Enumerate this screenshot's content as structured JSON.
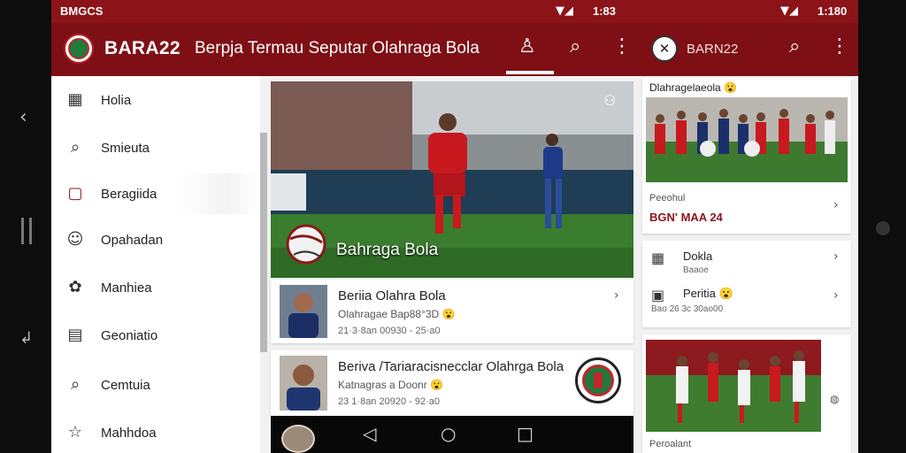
{
  "status": {
    "left_text": "BMGCS",
    "time_mid": "1:83",
    "time_right": "1:180"
  },
  "appbar": {
    "brand": "BARA22",
    "tagline": "Berpja Termau Seputar Olahraga Bola",
    "brand_secondary": "BARN22",
    "icons": [
      "person-tab-icon",
      "search-icon",
      "more-vert-icon",
      "search-icon",
      "more-vert-icon"
    ]
  },
  "drawer": {
    "items": [
      {
        "icon": "calendar-icon",
        "label": "Holia"
      },
      {
        "icon": "search-icon",
        "label": "Smieuta"
      },
      {
        "icon": "square-icon",
        "label": "Beragiida"
      },
      {
        "icon": "face-icon",
        "label": "Opahadan"
      },
      {
        "icon": "apps-icon",
        "label": "Manhiea"
      },
      {
        "icon": "grid-icon",
        "label": "Geoniatio"
      },
      {
        "icon": "search-icon",
        "label": "Cemtuia"
      },
      {
        "icon": "star-icon",
        "label": "Mahhdoa"
      }
    ]
  },
  "feed": {
    "hero": {
      "caption": "Bahraga Bola"
    },
    "cards": [
      {
        "title": "Beriia Olahra Bola",
        "subtitle": "Olahragae Bap88°3D 😮",
        "meta": "21·3·8an 00930 - 25·a0"
      },
      {
        "title": "Beriva /Tariaracisnecclar Olahrga Bola",
        "subtitle": "Katnagras a Doonr 😮",
        "meta": "23 1·8an 20920 - 92·a0"
      }
    ]
  },
  "right": {
    "card1": {
      "title": "Dlahragelaeola 😮",
      "label": "Peeohul",
      "date": "BGN' MAA 24"
    },
    "card2": {
      "rows": [
        {
          "title": "Dokla",
          "sub": "Baaoe"
        },
        {
          "title": "Peritia 😮",
          "sub": "Bao  26 3c 30ao00"
        }
      ]
    },
    "card3": {
      "label": "Peroalant"
    }
  },
  "colors": {
    "primary": "#7e1015",
    "status": "#8c1418"
  }
}
